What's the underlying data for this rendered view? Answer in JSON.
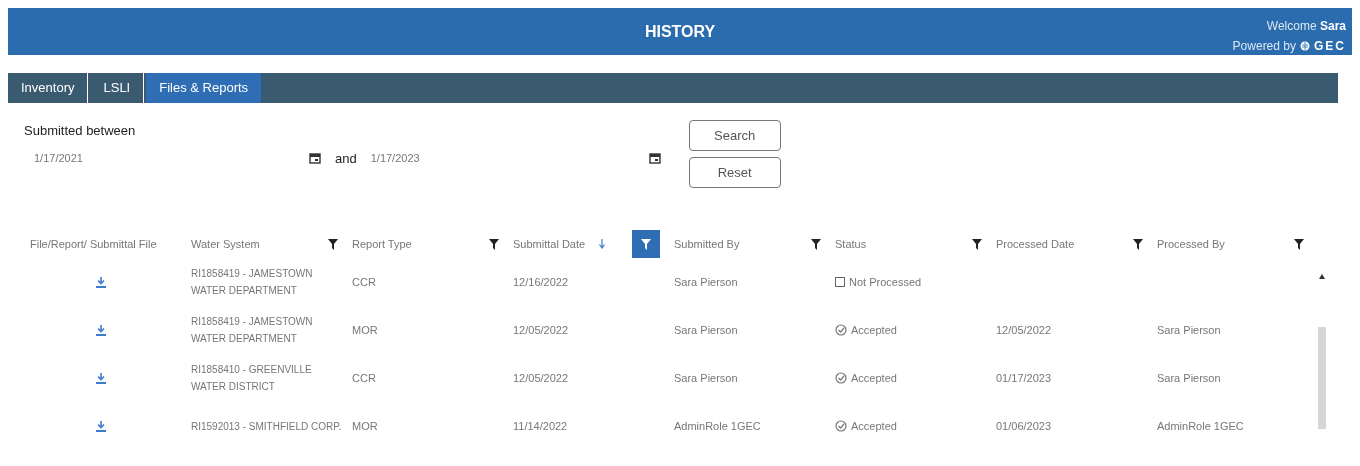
{
  "header": {
    "title": "HISTORY",
    "welcome": "Welcome",
    "user": "Sara",
    "powered_by": "Powered by",
    "brand": "GEC"
  },
  "tabs": [
    {
      "label": "Inventory",
      "selected": false
    },
    {
      "label": "LSLI",
      "selected": false
    },
    {
      "label": "Files & Reports",
      "selected": true
    }
  ],
  "filter_form": {
    "label": "Submitted between",
    "from": "1/17/2021",
    "conjunction": "and",
    "to": "1/17/2023",
    "buttons": [
      "Search",
      "Reset"
    ]
  },
  "table": {
    "columns": [
      {
        "label": "File/Report/ Submittal File",
        "kind": "plain"
      },
      {
        "label": "Water System",
        "kind": "filterable",
        "filter_active": false
      },
      {
        "label": "Report Type",
        "kind": "filterable",
        "filter_active": false
      },
      {
        "label": "Submittal Date",
        "kind": "filterable",
        "filter_active": true,
        "sorted": true
      },
      {
        "label": "Submitted By",
        "kind": "filterable",
        "filter_active": false
      },
      {
        "label": "Status",
        "kind": "filterable",
        "filter_active": false
      },
      {
        "label": "Processed Date",
        "kind": "filterable",
        "filter_active": false
      },
      {
        "label": "Processed By",
        "kind": "filterable",
        "filter_active": false
      }
    ],
    "rows": [
      {
        "water_system": "RI1858419 - JAMESTOWN WATER DEPARTMENT",
        "report_type": "CCR",
        "submittal_date": "12/16/2022",
        "submitted_by": "Sara Pierson",
        "status": {
          "label": "Not Processed",
          "kind": "pending"
        }
      },
      {
        "water_system": "RI1858419 - JAMESTOWN WATER DEPARTMENT",
        "report_type": "MOR",
        "submittal_date": "12/05/2022",
        "submitted_by": "Sara Pierson",
        "status": {
          "label": "Accepted",
          "kind": "accepted"
        },
        "processed_date": "12/05/2022",
        "processed_by": "Sara Pierson"
      },
      {
        "water_system": "RI1858410 - GREENVILLE WATER DISTRICT",
        "report_type": "CCR",
        "submittal_date": "12/05/2022",
        "submitted_by": "Sara Pierson",
        "status": {
          "label": "Accepted",
          "kind": "accepted"
        },
        "processed_date": "01/17/2023",
        "processed_by": "Sara Pierson"
      },
      {
        "water_system": "RI1592013 - SMITHFIELD CORP.",
        "report_type": "MOR",
        "submittal_date": "11/14/2022",
        "submitted_by": "AdminRole 1GEC",
        "status": {
          "label": "Accepted",
          "kind": "accepted"
        },
        "processed_date": "01/06/2023",
        "processed_by": "AdminRole 1GEC"
      }
    ]
  }
}
